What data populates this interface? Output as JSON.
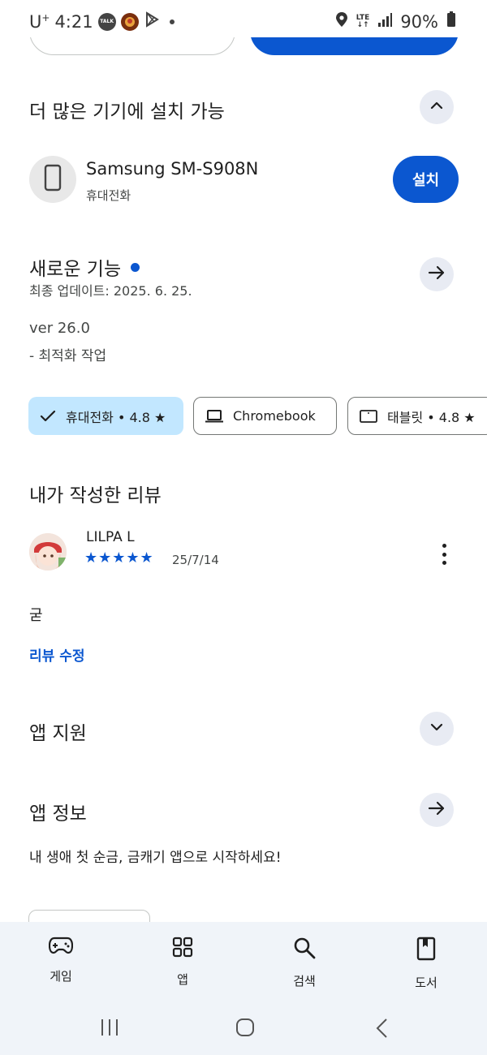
{
  "status_bar": {
    "carrier": "U",
    "carrier_sup": "+",
    "time": "4:21",
    "lte_top": "LTE",
    "lte_bottom": "↓↑",
    "battery": "90%"
  },
  "more_devices": {
    "title": "더 많은 기기에 설치 가능",
    "device_name": "Samsung SM-S908N",
    "device_type": "휴대전화",
    "install_label": "설치"
  },
  "whats_new": {
    "title": "새로운 기능",
    "updated": "최종 업데이트: 2025. 6. 25.",
    "version": "ver 26.0",
    "notes": "- 최적화 작업"
  },
  "device_chips": [
    {
      "label": "휴대전화 • 4.8 ★",
      "selected": true
    },
    {
      "label": "Chromebook",
      "selected": false
    },
    {
      "label": "태블릿 • 4.8 ★",
      "selected": false
    }
  ],
  "my_review": {
    "title": "내가 작성한 리뷰",
    "reviewer": "LILPA L",
    "stars": "★★★★★",
    "rating": 5,
    "date": "25/7/14",
    "text": "굳",
    "edit_label": "리뷰 수정"
  },
  "app_support": {
    "title": "앱 지원"
  },
  "app_info": {
    "title": "앱 정보",
    "description": "내 생애 첫 순금, 금캐기 앱으로 시작하세요!"
  },
  "bottom_nav": {
    "items": [
      {
        "label": "게임",
        "icon": "gamepad-icon"
      },
      {
        "label": "앱",
        "icon": "apps-grid-icon"
      },
      {
        "label": "검색",
        "icon": "search-icon"
      },
      {
        "label": "도서",
        "icon": "book-icon"
      }
    ]
  },
  "colors": {
    "accent": "#0b57d0",
    "chip_selected": "#c2e7ff",
    "nav_bg": "#f0f4f9",
    "round_button_bg": "#e8ebf3"
  }
}
